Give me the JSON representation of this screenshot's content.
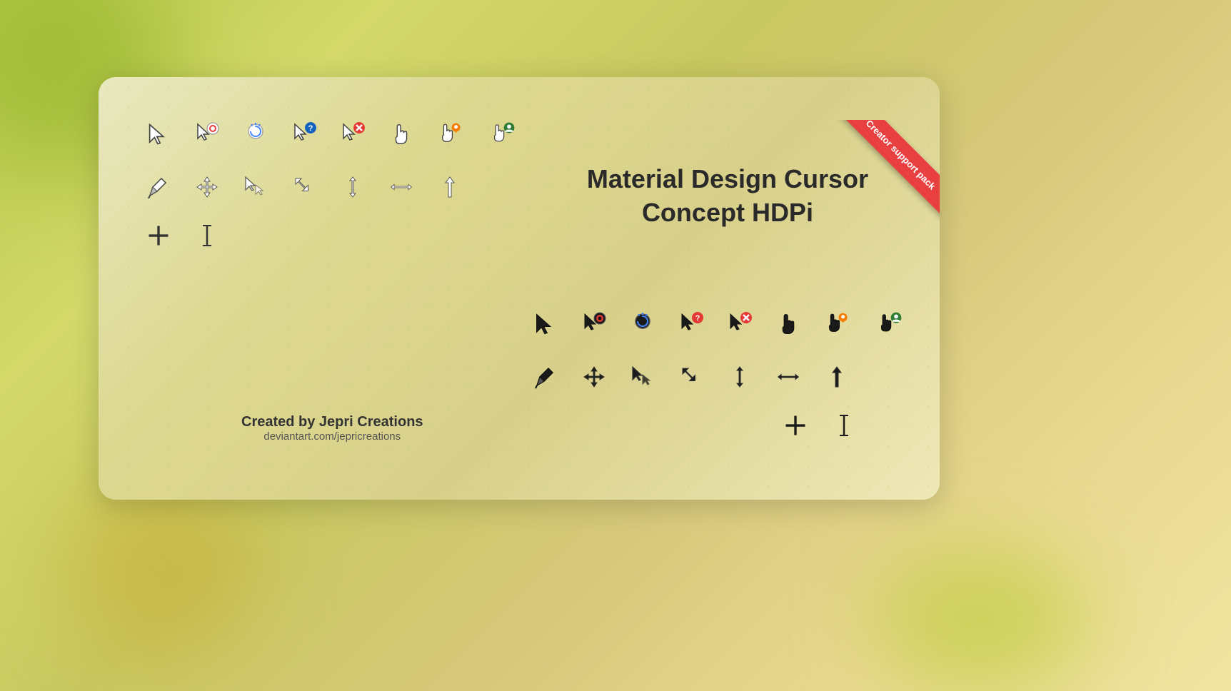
{
  "page": {
    "bg_colors": [
      "#b5c84a",
      "#d4d96a",
      "#c8c860",
      "#d6c87a",
      "#e8d890"
    ],
    "card": {
      "bg_start": "#e8e8c0",
      "bg_end": "#efe8b8"
    },
    "ribbon": {
      "text": "Creator support pack",
      "color": "#e84040"
    },
    "title": {
      "line1": "Material Design Cursor",
      "line2": "Concept HDPi"
    },
    "creator": {
      "name": "Created by Jepri Creations",
      "url": "deviantart.com/jepricreations"
    },
    "cursor_section_white": {
      "label": "white-cursor-section"
    },
    "cursor_section_dark": {
      "label": "dark-cursor-section"
    }
  }
}
